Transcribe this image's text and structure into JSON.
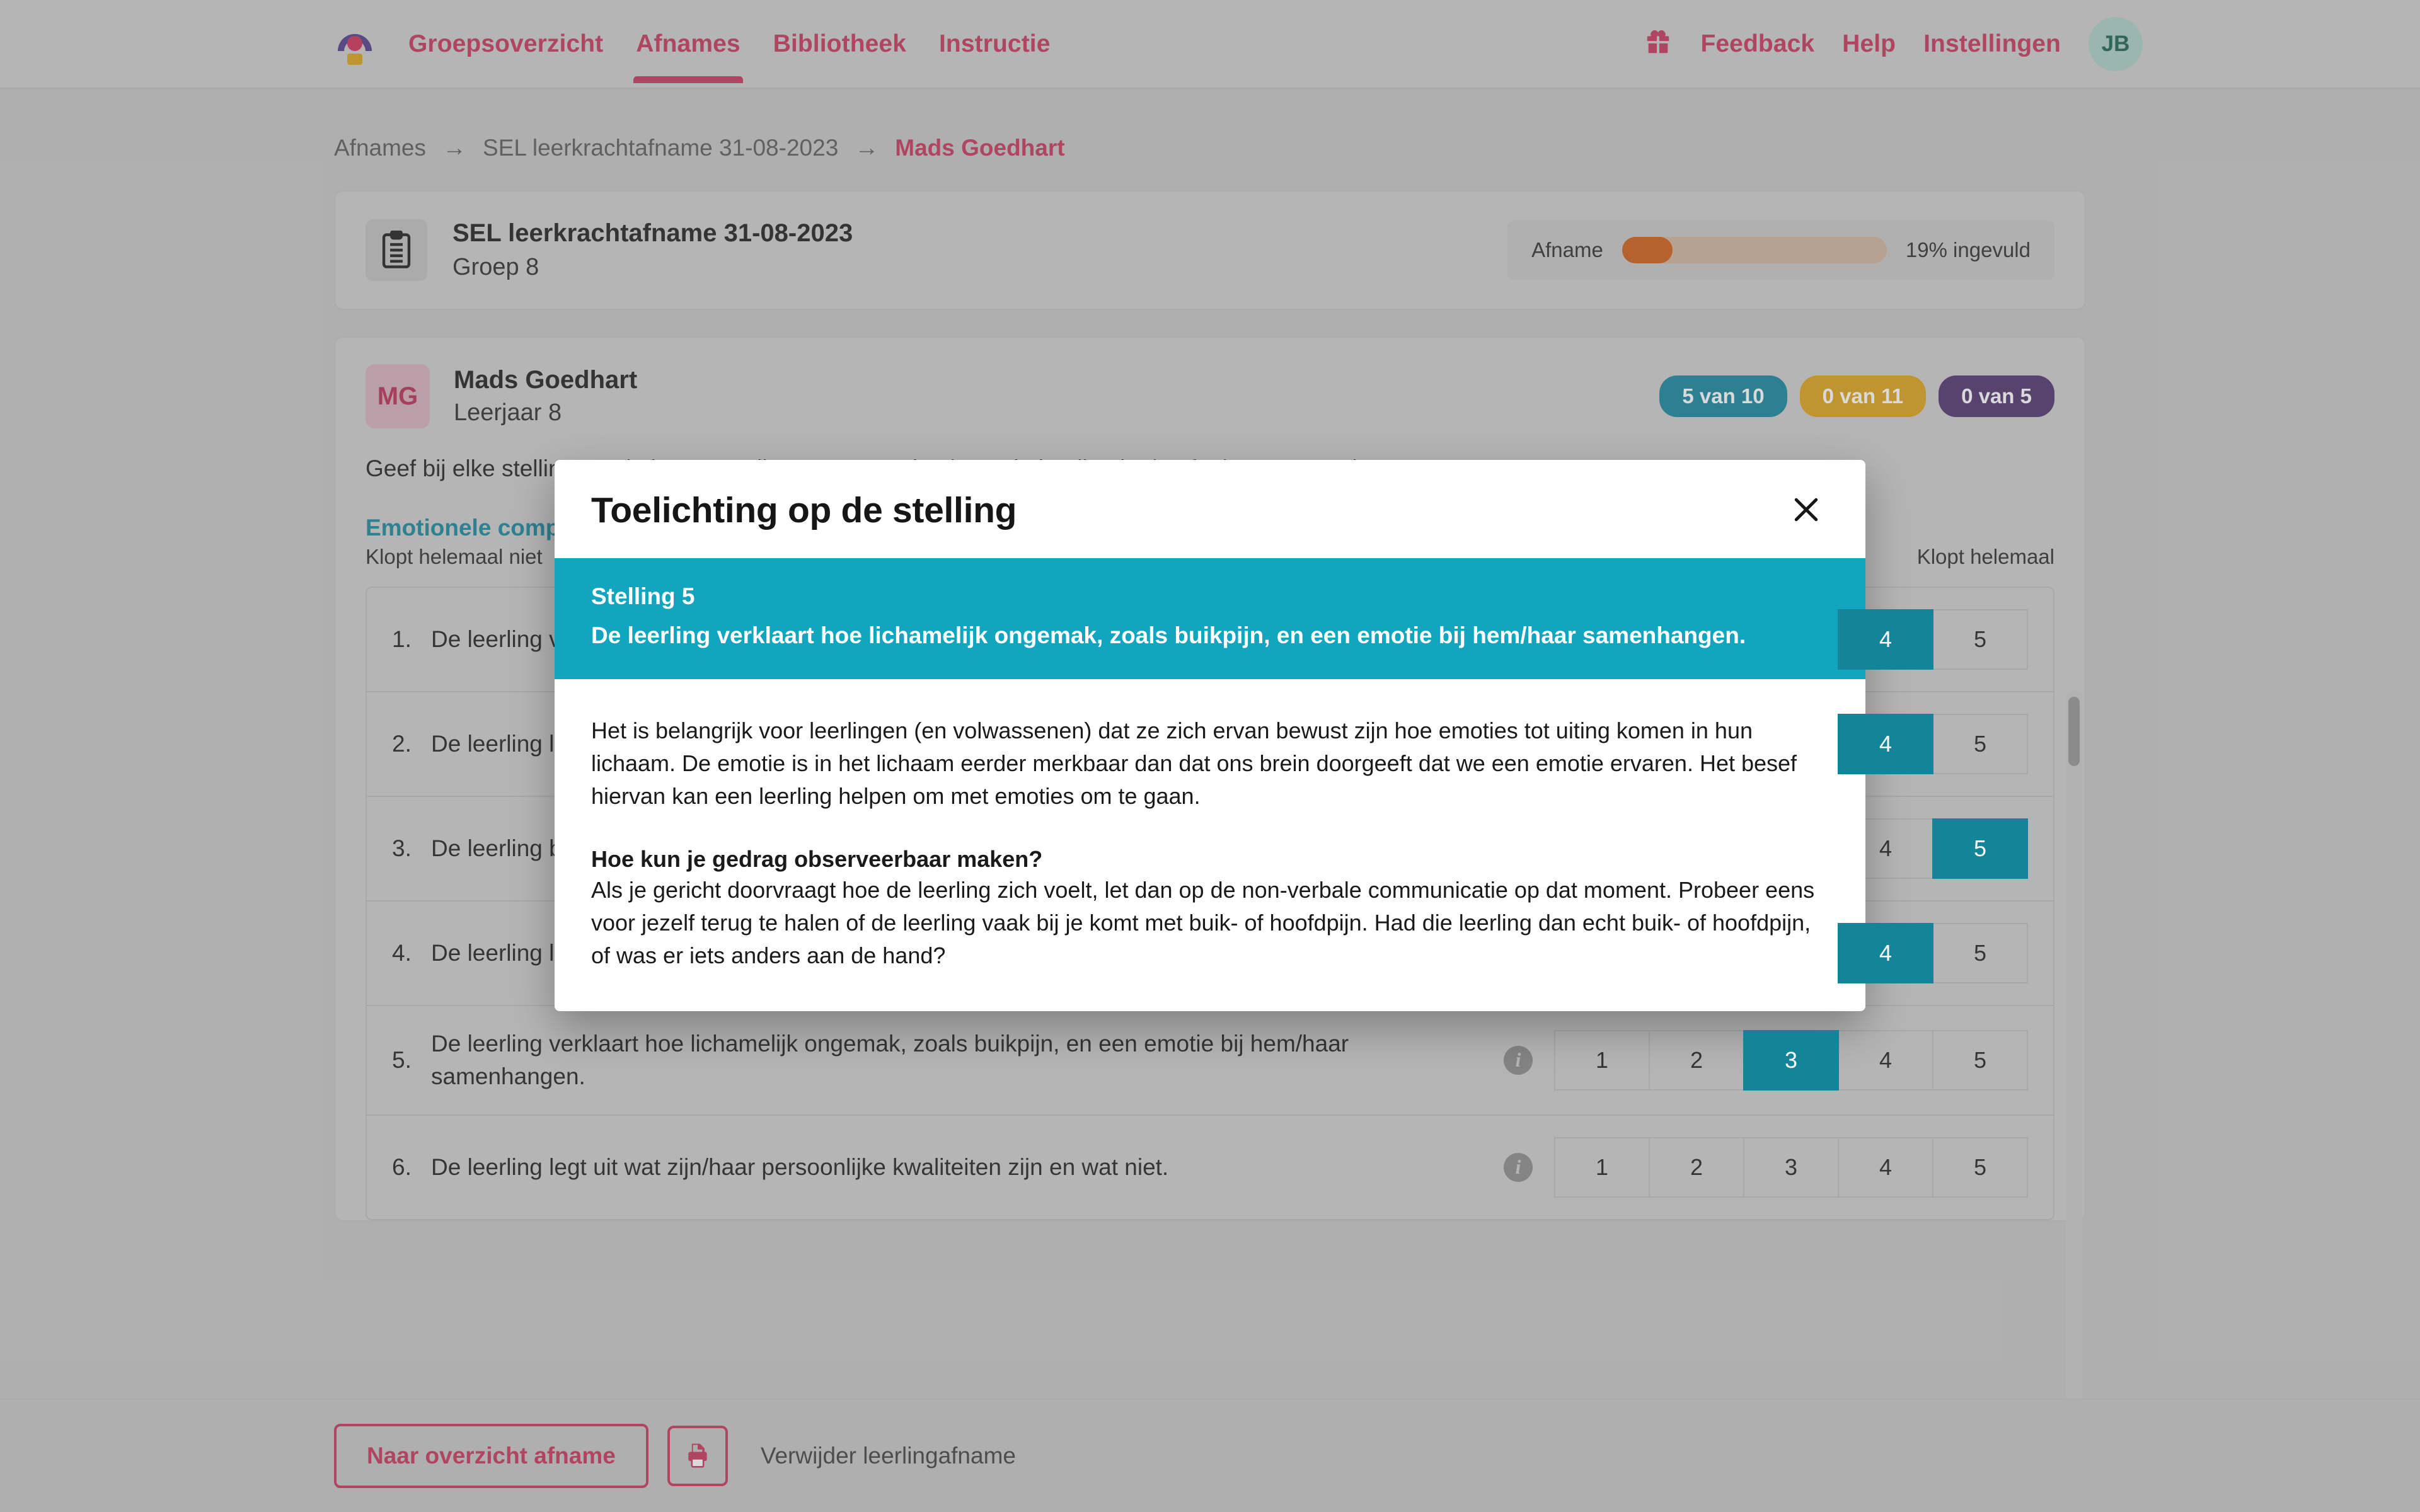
{
  "topbar": {
    "logo_name": "ZIEN logo",
    "nav": [
      {
        "label": "Groepsoverzicht",
        "active": false
      },
      {
        "label": "Afnames",
        "active": true
      },
      {
        "label": "Bibliotheek",
        "active": false
      },
      {
        "label": "Instructie",
        "active": false
      }
    ],
    "right": [
      {
        "label": "Feedback"
      },
      {
        "label": "Help"
      },
      {
        "label": "Instellingen"
      }
    ],
    "gift_icon": "gift-icon",
    "avatar_initials": "JB"
  },
  "breadcrumb": {
    "items": [
      "Afnames",
      "SEL leerkrachtafname 31-08-2023",
      "Mads Goedhart"
    ],
    "separator": "→"
  },
  "afname_card": {
    "icon": "clipboard-icon",
    "title": "SEL leerkrachtafname 31-08-2023",
    "subtitle": "Groep 8",
    "progress_label": "Afname",
    "progress_percent": 19,
    "progress_text": "19% ingevuld",
    "progress_color": "#cc5a12"
  },
  "student_card": {
    "initials": "MG",
    "name": "Mads Goedhart",
    "subtitle": "Leerjaar 8",
    "badges": [
      {
        "label": "5 van 10",
        "color": "#11849b"
      },
      {
        "label": "0 van 11",
        "color": "#ddа017"
      },
      {
        "label": "0 van 5",
        "color": "#4d2f6b"
      }
    ],
    "intro_text": "Geef bij elke stelling aan in hoeverre die van toepassing is op de leerling in de afgelopen maand.",
    "section_title": "Emotionele competenties",
    "scale_hint_left": "Klopt helemaal niet",
    "scale_hint_right": "Klopt helemaal"
  },
  "questions": [
    {
      "num": "1.",
      "text": "De leerling vertelt hoe hij/zij zich voelt.",
      "has_info": false,
      "selected": 4
    },
    {
      "num": "2.",
      "text": "De leerling legt uit waarom een bepaalde gebeurtenis invloed op hem/haar of op anderen heeft.",
      "has_info": false,
      "selected": 4
    },
    {
      "num": "3.",
      "text": "De leerling benoemt bij zichzelf verschillende emoties, zoals prettig, blij, verdrietig of boos.",
      "has_info": false,
      "selected": 5
    },
    {
      "num": "4.",
      "text": "De leerling legt uit en verklaart aan anderen hoe hij/zij zich voelt.",
      "has_info": false,
      "selected": 4
    },
    {
      "num": "5.",
      "text": "De leerling verklaart hoe lichamelijk ongemak, zoals buikpijn, en een emotie bij hem/haar samenhangen.",
      "has_info": true,
      "selected": 3
    },
    {
      "num": "6.",
      "text": "De leerling legt uit wat zijn/haar persoonlijke kwaliteiten zijn en wat niet.",
      "has_info": true,
      "selected": 0
    }
  ],
  "scale_options": [
    "1",
    "2",
    "3",
    "4",
    "5"
  ],
  "footer": {
    "back_button": "Naar overzicht afname",
    "print_icon": "printer-icon",
    "delete_link": "Verwijder leerlingafname"
  },
  "modal": {
    "title": "Toelichting op de stelling",
    "close_icon": "close-icon",
    "banner_label": "Stelling 5",
    "banner_statement": "De leerling verklaart hoe lichamelijk ongemak, zoals buikpijn, en een emotie bij hem/haar samenhangen.",
    "banner_color": "#12a5c0",
    "paragraph_1": "Het is belangrijk voor leerlingen (en volwassenen) dat ze zich ervan bewust zijn hoe emoties tot uiting komen in hun lichaam. De emotie is in het lichaam eerder merkbaar dan dat ons brein doorgeeft dat we een emotie ervaren. Het besef hiervan kan een leerling helpen om met emoties om te gaan.",
    "heading_2": "Hoe kun je gedrag observeerbaar maken?",
    "paragraph_2": "Als je gericht doorvraagt hoe de leerling zich voelt, let dan op de non-verbale communicatie op dat moment. Probeer eens voor jezelf terug te halen of de leerling vaak bij je komt met buik- of hoofdpijn. Had die leerling dan echt buik- of hoofdpijn, of was er iets anders aan de hand?"
  }
}
